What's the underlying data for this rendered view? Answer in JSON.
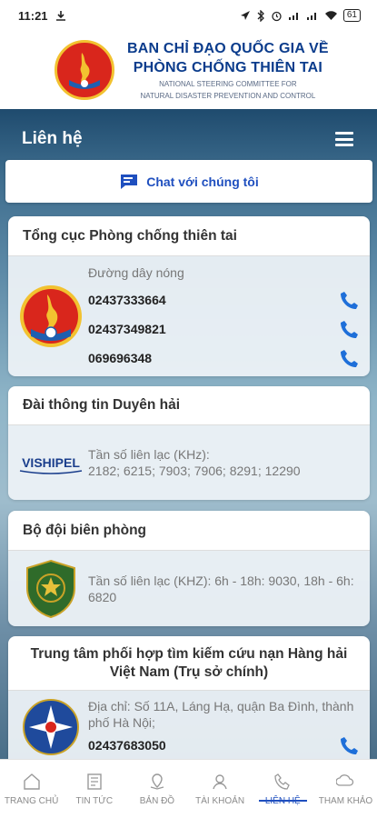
{
  "status_bar": {
    "time": "11:21",
    "battery": "61"
  },
  "banner": {
    "title_line1": "BAN CHỈ ĐẠO QUỐC GIA VỀ",
    "title_line2": "PHÒNG CHỐNG THIÊN TAI",
    "subtitle_line1": "NATIONAL STEERING COMMITTEE FOR",
    "subtitle_line2": "NATURAL DISASTER PREVENTION AND CONTROL"
  },
  "header": {
    "title": "Liên hệ"
  },
  "chat_button": {
    "label": "Chat với chúng tôi"
  },
  "cards": [
    {
      "title": "Tổng cục Phòng chống thiên tai",
      "hotline_label": "Đường dây nóng",
      "phones": [
        "02437333664",
        "02437349821",
        "069696348"
      ]
    },
    {
      "title": "Đài thông tin Duyên hải",
      "logo_text": "VISHIPEL",
      "freq_label": "Tần số liên lạc (KHz):",
      "freq_values": "2182; 6215; 7903; 7906; 8291; 12290"
    },
    {
      "title": "Bộ đội biên phòng",
      "freq_text": "Tần số liên lạc (KHZ): 6h - 18h: 9030, 18h - 6h: 6820"
    },
    {
      "title": "Trung tâm phối hợp tìm kiếm cứu nạn Hàng hải Việt Nam (Trụ sở chính)",
      "address": "Địa chỉ: Số 11A, Láng Hạ, quận Ba Đình, thành phố Hà Nội;",
      "phone": "02437683050"
    }
  ],
  "nav": [
    {
      "label": "TRANG CHỦ",
      "icon": "home-icon"
    },
    {
      "label": "TIN TỨC",
      "icon": "news-icon"
    },
    {
      "label": "BẢN ĐỒ",
      "icon": "map-icon"
    },
    {
      "label": "TÀI KHOẢN",
      "icon": "account-icon"
    },
    {
      "label": "LIÊN HỆ",
      "icon": "contact-icon",
      "active": true
    },
    {
      "label": "THAM KHẢO",
      "icon": "reference-icon"
    }
  ],
  "colors": {
    "accent": "#1f4fbf",
    "title_blue": "#0b3c8c",
    "phone_blue": "#1e6fd9"
  }
}
